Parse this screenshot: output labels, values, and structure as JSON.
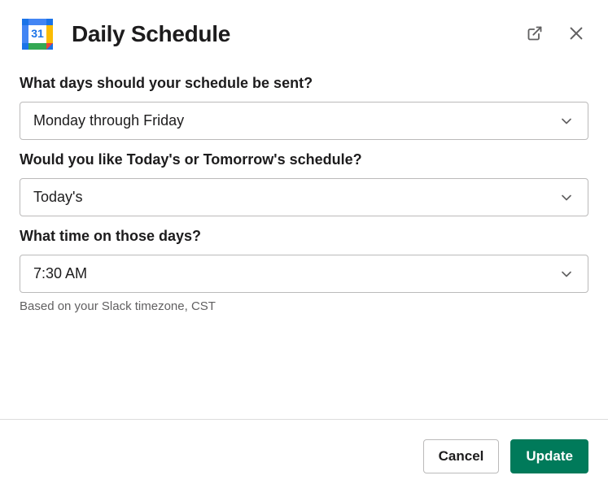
{
  "header": {
    "app_icon_day": "31",
    "title": "Daily Schedule"
  },
  "fields": {
    "days": {
      "label": "What days should your schedule be sent?",
      "value": "Monday through Friday"
    },
    "which": {
      "label": "Would you like Today's or Tomorrow's schedule?",
      "value": "Today's"
    },
    "time": {
      "label": "What time on those days?",
      "value": "7:30 AM",
      "helper": "Based on your Slack timezone, CST"
    }
  },
  "footer": {
    "cancel": "Cancel",
    "update": "Update"
  }
}
